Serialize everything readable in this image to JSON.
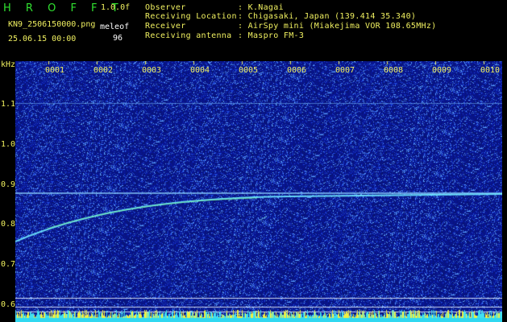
{
  "header": {
    "app_title": "H R O F F T",
    "version": "1.0.0f",
    "filename": "KN9_2506150000.png",
    "mode": "meleof",
    "datetime": "25.06.15 00:00",
    "count": "96"
  },
  "station": {
    "rows": [
      {
        "label": "Observer",
        "value": ": K.Nagai"
      },
      {
        "label": "Receiving Location",
        "value": ": Chigasaki, Japan (139.414 35.340)"
      },
      {
        "label": "Receiver",
        "value": ": AirSpy mini (Miakejima VOR 108.65MHz)"
      },
      {
        "label": "Receiving antenna",
        "value": ": Maspro FM-3"
      }
    ]
  },
  "axis": {
    "unit": "kHz",
    "y_labels": [
      "1.1",
      "1.0",
      "0.9",
      "0.8",
      "0.7",
      "0.6"
    ],
    "x_labels": [
      "0001",
      "0002",
      "0003",
      "0004",
      "0005",
      "0006",
      "0007",
      "0008",
      "0009",
      "0010"
    ]
  },
  "colors": {
    "background": "#000000",
    "noise_base": "#0a1a8a",
    "trace": "#60e0ff",
    "text_green": "#30e030",
    "text_yellow": "#f0f060"
  }
}
